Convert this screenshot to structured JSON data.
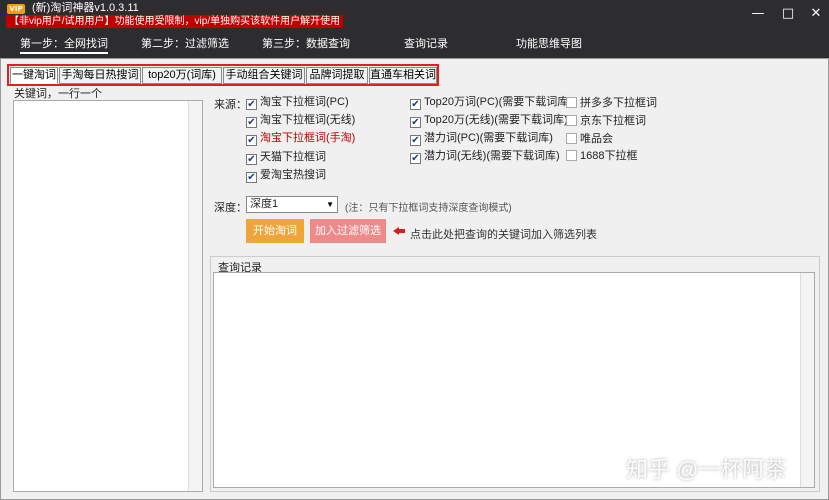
{
  "titlebar": {
    "logo_text": "VIP",
    "title": "(新)淘词神器v1.0.3.11",
    "warning": "【非vip用户/试用用户】功能使用受限制，vip/单独购买该软件用户解开使用",
    "minimize": "—",
    "maximize": "□",
    "close": "✕"
  },
  "menu": {
    "items": [
      "第一步：全网找词",
      "第二步：过滤筛选",
      "第三步：数据查询",
      "查询记录",
      "功能思维导图"
    ]
  },
  "tabs": [
    "一键淘词",
    "手淘每日热搜词",
    "top20万(词库)",
    "手动组合关键词",
    "品牌词提取",
    "直通车相关词"
  ],
  "keywords": {
    "label": "关键词，一行一个",
    "value": ""
  },
  "source": {
    "label": "来源：",
    "options": [
      {
        "label": "淘宝下拉框词(PC)",
        "checked": true
      },
      {
        "label": "淘宝下拉框词(无线)",
        "checked": true
      },
      {
        "label": "淘宝下拉框词(手淘)",
        "checked": true
      },
      {
        "label": "天猫下拉框词",
        "checked": true
      },
      {
        "label": "爱淘宝热搜词",
        "checked": true
      },
      {
        "label": "Top20万词(PC)(需要下载词库)",
        "checked": true
      },
      {
        "label": "Top20万(无线)(需要下载词库)",
        "checked": true
      },
      {
        "label": "潜力词(PC)(需要下载词库)",
        "checked": true
      },
      {
        "label": "潜力词(无线)(需要下载词库)",
        "checked": true
      },
      {
        "label": "拼多多下拉框词",
        "checked": false
      },
      {
        "label": "京东下拉框词",
        "checked": false
      },
      {
        "label": "唯品会",
        "checked": false
      },
      {
        "label": "1688下拉框",
        "checked": false
      }
    ]
  },
  "depth": {
    "label": "深度：",
    "selected": "深度1",
    "note": "(注：只有下拉框词支持深度查询模式)"
  },
  "buttons": {
    "start": "开始淘词",
    "add_filter": "加入过滤筛选"
  },
  "hint": "点击此处把查询的关键词加入筛选列表",
  "log": {
    "label": "查询记录",
    "value": ""
  },
  "watermark": "知乎 @一杯阿茶",
  "colors": {
    "titlebar_bg": "#2d2d30",
    "warning_bg": "#c00000",
    "highlight_border": "#e02020",
    "start_button": "#f0a43c",
    "filter_button": "#ee8a8a"
  }
}
